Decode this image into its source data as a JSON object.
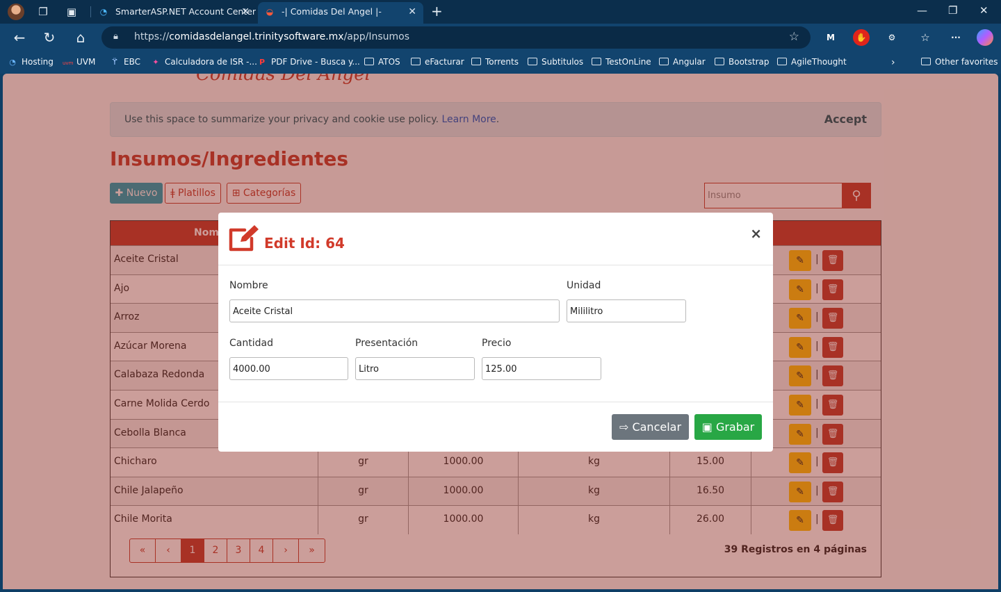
{
  "browser": {
    "tabs": [
      {
        "title": "SmarterASP.NET Account Center",
        "icon": "smarterasp-icon"
      },
      {
        "title": "-| Comidas Del Angel |-",
        "icon": "dish-icon"
      }
    ],
    "url_prefix": "https://",
    "url_host": "comidasdelangel.trinitysoftware.mx",
    "url_path": "/app/Insumos",
    "favorites": [
      {
        "label": "Hosting",
        "icon": "hosting-icon"
      },
      {
        "label": "UVM",
        "icon": "uvm-icon"
      },
      {
        "label": "EBC",
        "icon": "ebc-icon"
      },
      {
        "label": "Calculadora de ISR -...",
        "icon": "calculator-icon"
      },
      {
        "label": "PDF Drive - Busca y...",
        "icon": "pdf-icon"
      },
      {
        "label": "ATOS",
        "icon": "folder-icon"
      },
      {
        "label": "eFacturar",
        "icon": "folder-icon"
      },
      {
        "label": "Torrents",
        "icon": "folder-icon"
      },
      {
        "label": "Subtitulos",
        "icon": "folder-icon"
      },
      {
        "label": "TestOnLine",
        "icon": "folder-icon"
      },
      {
        "label": "Angular",
        "icon": "folder-icon"
      },
      {
        "label": "Bootstrap",
        "icon": "folder-icon"
      },
      {
        "label": "AgileThought",
        "icon": "folder-icon"
      }
    ],
    "other_favorites": "Other favorites"
  },
  "page": {
    "logo_text": "Comidas Del Angel",
    "cookie_message": "Use this space to summarize your privacy and cookie use policy.",
    "cookie_link": "Learn More",
    "cookie_accept": "Accept",
    "title": "Insumos/Ingredientes",
    "btn_new": "Nuevo",
    "btn_platillos": "Platillos",
    "btn_categorias": "Categorías",
    "search_placeholder": "Insumo",
    "grid_header_name": "Nom",
    "rows": [
      {
        "name": "Aceite Cristal",
        "unit": "",
        "qty": "",
        "pres": "",
        "price": ""
      },
      {
        "name": "Ajo",
        "unit": "",
        "qty": "",
        "pres": "",
        "price": ""
      },
      {
        "name": "Arroz",
        "unit": "",
        "qty": "",
        "pres": "",
        "price": ""
      },
      {
        "name": "Azúcar Morena",
        "unit": "",
        "qty": "",
        "pres": "",
        "price": ""
      },
      {
        "name": "Calabaza Redonda",
        "unit": "",
        "qty": "",
        "pres": "",
        "price": ""
      },
      {
        "name": "Carne Molida Cerdo",
        "unit": "",
        "qty": "",
        "pres": "",
        "price": ""
      },
      {
        "name": "Cebolla Blanca",
        "unit": "",
        "qty": "",
        "pres": "",
        "price": ""
      },
      {
        "name": "Chicharo",
        "unit": "gr",
        "qty": "1000.00",
        "pres": "kg",
        "price": "15.00"
      },
      {
        "name": "Chile Jalapeño",
        "unit": "gr",
        "qty": "1000.00",
        "pres": "kg",
        "price": "16.50"
      },
      {
        "name": "Chile Morita",
        "unit": "gr",
        "qty": "1000.00",
        "pres": "kg",
        "price": "26.00"
      }
    ],
    "pager": [
      "«",
      "‹",
      "1",
      "2",
      "3",
      "4",
      "›",
      "»"
    ],
    "pager_active": "1",
    "records_text": "39 Registros en 4 páginas"
  },
  "modal": {
    "title": "Edit Id: 64",
    "close": "×",
    "fields": {
      "nombre_label": "Nombre",
      "nombre_value": "Aceite Cristal",
      "unidad_label": "Unidad",
      "unidad_value": "Mililitro",
      "cantidad_label": "Cantidad",
      "cantidad_value": "4000.00",
      "presentacion_label": "Presentación",
      "presentacion_value": "Litro",
      "precio_label": "Precio",
      "precio_value": "125.00"
    },
    "btn_cancel": "Cancelar",
    "btn_save": "Grabar"
  },
  "colors": {
    "brand_red": "#c0392b",
    "success": "#28a745",
    "secondary": "#6c757d",
    "warning": "#ffc107",
    "info": "#17a2b8"
  }
}
